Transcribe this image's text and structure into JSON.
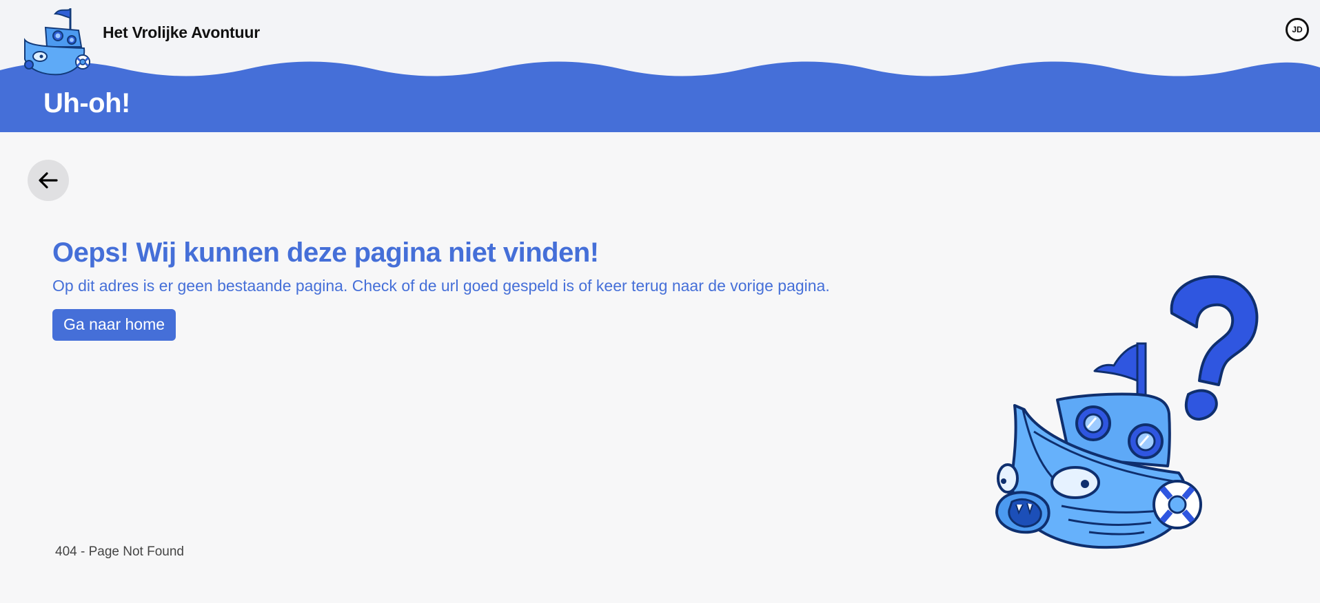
{
  "header": {
    "brand_name": "Het Vrolijke Avontuur",
    "user_initials": "JD",
    "page_title": "Uh-oh!"
  },
  "error": {
    "headline": "Oeps! Wij kunnen deze pagina niet vinden!",
    "message": "Op dit adres is er geen bestaande pagina. Check of de url goed gespeld is of keer terug naar de vorige pagina.",
    "home_button_label": "Ga naar home",
    "status_code_text": "404 - Page Not Found"
  },
  "icons": {
    "back": "arrow-left-icon",
    "logo": "boat-logo-icon",
    "illustration": "confused-boat-question-illustration"
  },
  "colors": {
    "brand_blue": "#456fd8",
    "header_bg": "#f3f4f7",
    "page_bg": "#f7f7f8",
    "back_button_bg": "#e0e0e2"
  }
}
